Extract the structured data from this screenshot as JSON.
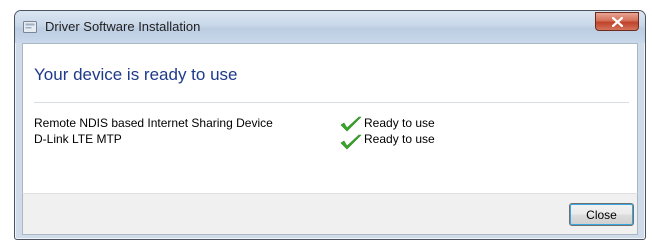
{
  "window": {
    "title": "Driver Software Installation"
  },
  "content": {
    "heading": "Your device is ready to use",
    "devices": [
      {
        "name": "Remote NDIS based Internet Sharing Device",
        "status": "Ready to use",
        "status_icon": "checkmark-icon"
      },
      {
        "name": "D-Link LTE MTP",
        "status": "Ready to use",
        "status_icon": "checkmark-icon"
      }
    ]
  },
  "footer": {
    "close_label": "Close"
  },
  "colors": {
    "heading": "#1e3a8a",
    "checkmark": "#3aa52c",
    "close_button_red": "#c0422a"
  }
}
